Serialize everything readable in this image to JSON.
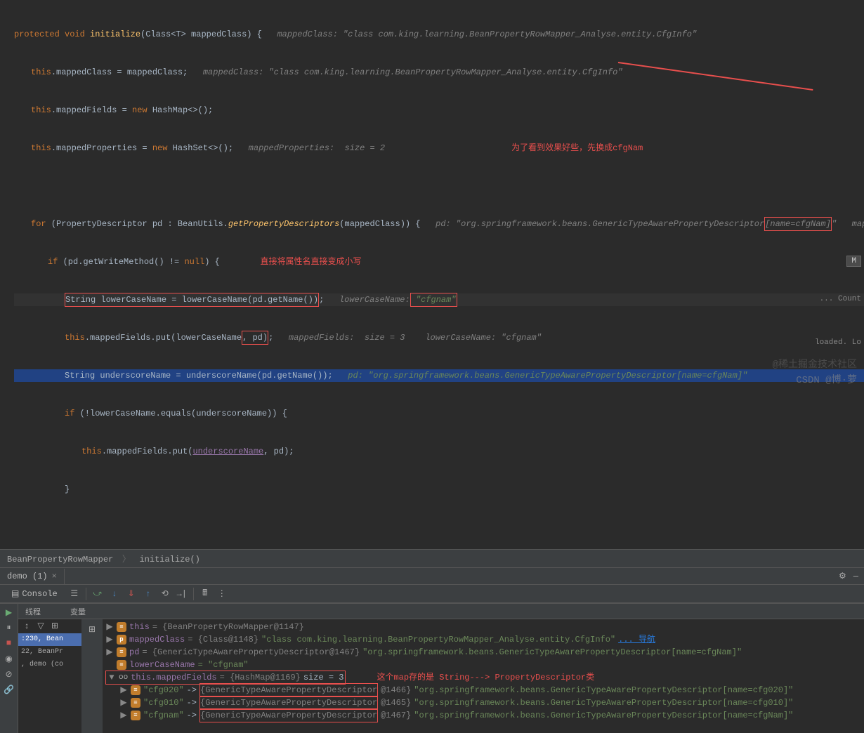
{
  "code": {
    "l1_a": "protected void ",
    "l1_b": "initialize",
    "l1_c": "(Class<T> mappedClass) {",
    "l1_hint": "   mappedClass: \"class com.king.learning.BeanPropertyRowMapper_Analyse.entity.CfgInfo\"",
    "l2_a": "this",
    "l2_b": ".mappedClass = mappedClass;",
    "l2_hint": "   mappedClass: \"class com.king.learning.BeanPropertyRowMapper_Analyse.entity.CfgInfo\"",
    "l3_a": "this",
    "l3_b": ".mappedFields = ",
    "l3_c": "new ",
    "l3_d": "HashMap<>();",
    "l4_a": "this",
    "l4_b": ".mappedProperties = ",
    "l4_c": "new ",
    "l4_d": "HashSet<>();",
    "l4_hint": "   mappedProperties:  size = 2",
    "anno1": "为了看到效果好些，先换成cfgNam",
    "l6_a": "for ",
    "l6_b": "(PropertyDescriptor pd : BeanUtils.",
    "l6_c": "getPropertyDescriptors",
    "l6_d": "(mappedClass)) {",
    "l6_hint_a": "   pd: \"org.springframework.beans.GenericTypeAwarePropertyDescriptor",
    "l6_hint_b": "[name=cfgNam]",
    "l6_hint_c": "\"   mappedCl",
    "l7_a": "if ",
    "l7_b": "(pd.getWriteMethod() != ",
    "l7_c": "null",
    "l7_d": ") {",
    "anno2": "        直接将属性名直接变成小写",
    "l8_a": "String lowerCaseName = lowerCaseName(pd.getName())",
    "l8_b": ";",
    "l8_hint_a": "   lowerCaseName:",
    "l8_hint_b": " \"cfgnam\"",
    "l9_a": "this",
    "l9_b": ".mappedFields.put(lowerCaseName",
    "l9_c": ", pd)",
    "l9_d": ";",
    "l9_hint": "   mappedFields:  size = 3    lowerCaseName: \"cfgnam\"",
    "l10_a": "String underscoreName = underscoreName(pd.getName());",
    "l10_hint": "   pd: \"org.springframework.beans.GenericTypeAwarePropertyDescriptor[name=cfgNam]\"",
    "l11_a": "if ",
    "l11_b": "(!lowerCaseName.equals(underscoreName)) {",
    "l12_a": "this",
    "l12_b": ".mappedFields.put(",
    "l12_c": "underscoreName",
    "l12_d": ", pd);",
    "l13": "}"
  },
  "breadcrumb": {
    "a": "BeanPropertyRowMapper",
    "b": "initialize()"
  },
  "tab": {
    "name": "demo (1)"
  },
  "toolbar": {
    "console": "Console"
  },
  "left_panel": {
    "threads": "线程",
    "f1": ":230, Bean",
    "f2": "22, BeanPr",
    "f3": ", demo (co"
  },
  "vars": {
    "header": "变量",
    "this_name": "this",
    "this_val": " = {BeanPropertyRowMapper@1147}",
    "mc_name": "mappedClass",
    "mc_type": " = {Class@1148} ",
    "mc_val": "\"class com.king.learning.BeanPropertyRowMapper_Analyse.entity.CfgInfo\"",
    "mc_nav": "... 导航",
    "pd_name": "pd",
    "pd_type": " = {GenericTypeAwarePropertyDescriptor@1467} ",
    "pd_val": "\"org.springframework.beans.GenericTypeAwarePropertyDescriptor[name=cfgNam]\"",
    "lcn_name": "lowerCaseName",
    "lcn_val": " = \"cfgnam\"",
    "mf_name": "this.mappedFields",
    "mf_type": " = {HashMap@1169} ",
    "mf_size": " size = 3",
    "anno3": "这个map存的是 String---> PropertyDescriptor类",
    "k1": "\"cfg020\"",
    "arrow": " -> ",
    "v1_type": "{GenericTypeAwarePropertyDescriptor",
    "v1_at": "@1466} ",
    "v1_val": "\"org.springframework.beans.GenericTypeAwarePropertyDescriptor[name=cfg020]\"",
    "k2": "\"cfg010\"",
    "v2_at": "@1465} ",
    "v2_val": "\"org.springframework.beans.GenericTypeAwarePropertyDescriptor[name=cfg010]\"",
    "k3": "\"cfgnam\"",
    "v3_at": "@1467} ",
    "v3_val": "\"org.springframework.beans.GenericTypeAwarePropertyDescriptor[name=cfgNam]\""
  },
  "right": {
    "m": "M",
    "count": "... Count",
    "loaded": "loaded. Lo"
  },
  "watermark": {
    "w1": "@稀土掘金技术社区",
    "w2": "CSDN @博·萝"
  }
}
